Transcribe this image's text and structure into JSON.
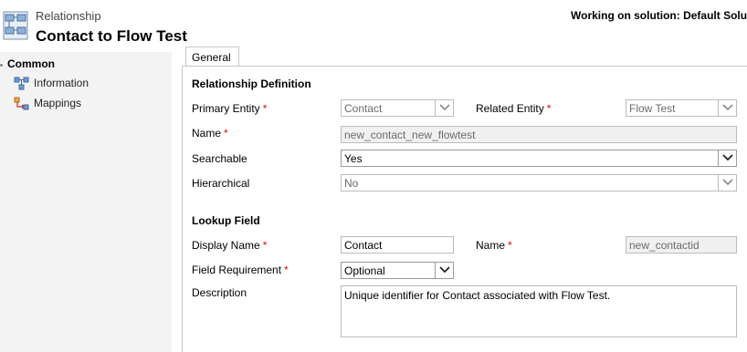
{
  "header": {
    "breadcrumb": "Relationship",
    "title": "Contact to Flow Test",
    "solution": "Working on solution: Default Soluti"
  },
  "nav": {
    "group_label": "Common",
    "collapse_glyph": "▪",
    "items": [
      {
        "label": "Information",
        "icon": "relationship-icon"
      },
      {
        "label": "Mappings",
        "icon": "mappings-icon"
      }
    ]
  },
  "tabs": [
    {
      "label": "General",
      "active": true
    }
  ],
  "relationship_definition": {
    "title": "Relationship Definition",
    "primary_entity": {
      "label": "Primary Entity",
      "value": "Contact"
    },
    "related_entity": {
      "label": "Related Entity",
      "value": "Flow Test"
    },
    "name": {
      "label": "Name",
      "value": "new_contact_new_flowtest"
    },
    "searchable": {
      "label": "Searchable",
      "value": "Yes"
    },
    "hierarchical": {
      "label": "Hierarchical",
      "value": "No"
    }
  },
  "lookup_field": {
    "title": "Lookup Field",
    "display_name": {
      "label": "Display Name",
      "value": "Contact"
    },
    "name": {
      "label": "Name",
      "value": "new_contactid"
    },
    "field_requirement": {
      "label": "Field Requirement",
      "value": "Optional"
    },
    "description": {
      "label": "Description",
      "value": "Unique identifier for Contact associated with Flow Test."
    }
  },
  "required_marker": "*",
  "colors": {
    "required": "#d01010",
    "nav_background": "#f3f3f3",
    "border": "#bcbcbc"
  }
}
